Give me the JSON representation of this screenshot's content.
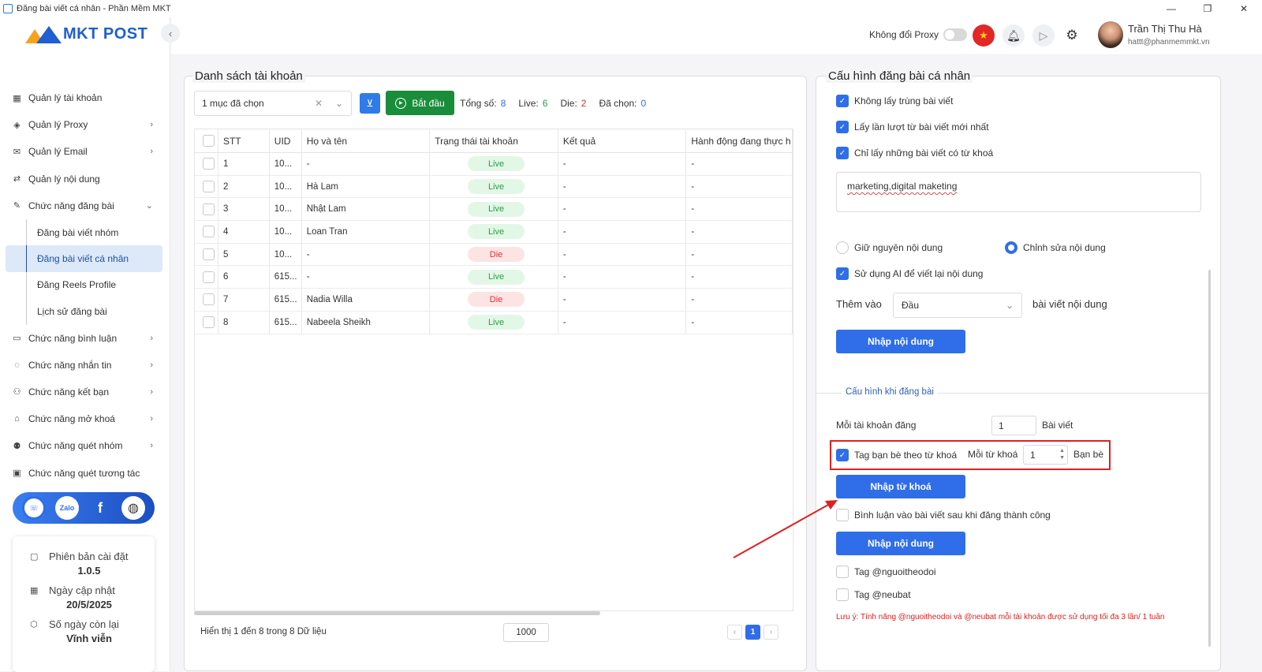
{
  "window": {
    "title": "Đăng bài viết cá nhân - Phần Mềm MKT",
    "controls": [
      "—",
      "❐",
      "✕"
    ]
  },
  "logo": {
    "text": "MKT POST"
  },
  "sidebar": {
    "items": [
      {
        "label": "Quản lý tài khoản",
        "icon": "grid-icon",
        "chev": ""
      },
      {
        "label": "Quản lý Proxy",
        "icon": "proxy-icon",
        "chev": "›"
      },
      {
        "label": "Quản lý Email",
        "icon": "email-icon",
        "chev": "›"
      },
      {
        "label": "Quản lý nội dung",
        "icon": "content-icon",
        "chev": ""
      },
      {
        "label": "Chức năng đăng bài",
        "icon": "post-icon",
        "chev": "⌄"
      }
    ],
    "subitems": [
      "Đăng bài viết nhóm",
      "Đăng bài viết cá nhân",
      "Đăng Reels Profile",
      "Lịch sử đăng bài"
    ],
    "items2": [
      {
        "label": "Chức năng bình luận",
        "icon": "comment-icon",
        "chev": "›"
      },
      {
        "label": "Chức năng nhắn tin",
        "icon": "message-icon",
        "chev": "›"
      },
      {
        "label": "Chức năng kết bạn",
        "icon": "add-friend-icon",
        "chev": "›"
      },
      {
        "label": "Chức năng mở khoá",
        "icon": "unlock-icon",
        "chev": "›"
      },
      {
        "label": "Chức năng quét nhóm",
        "icon": "group-icon",
        "chev": "›"
      },
      {
        "label": "Chức năng quét tương tác",
        "icon": "scan-icon",
        "chev": ""
      }
    ],
    "social": [
      "support-icon",
      "zalo-icon",
      "facebook-icon",
      "web-icon"
    ],
    "version": {
      "install_label": "Phiên bản cài đặt",
      "install_value": "1.0.5",
      "update_label": "Ngày cập nhật",
      "update_value": "20/5/2025",
      "days_label": "Số ngày còn lại",
      "days_value": "Vĩnh viễn"
    }
  },
  "topbar": {
    "proxy_label": "Không đổi Proxy",
    "user_name": "Trần Thị Thu Hà",
    "user_email": "hattt@phanmemmkt.vn"
  },
  "accounts": {
    "title": "Danh sách tài khoản",
    "select_value": "1 mục đã chọn",
    "start_label": "Bắt đầu",
    "total_label": "Tổng số:",
    "total": "8",
    "live_label": "Live:",
    "live": "6",
    "die_label": "Die:",
    "die": "2",
    "selected_label": "Đã chọn:",
    "selected": "0",
    "columns": [
      "STT",
      "UID",
      "Họ và tên",
      "Trạng thái tài khoản",
      "Kết quả",
      "Hành động đang thực h"
    ],
    "rows": [
      {
        "stt": "1",
        "uid": "10...",
        "name": "-",
        "status": "Live",
        "result": "-",
        "action": "-"
      },
      {
        "stt": "2",
        "uid": "10...",
        "name": "Hà Lam",
        "status": "Live",
        "result": "-",
        "action": "-"
      },
      {
        "stt": "3",
        "uid": "10...",
        "name": "Nhật Lam",
        "status": "Live",
        "result": "-",
        "action": "-"
      },
      {
        "stt": "4",
        "uid": "10...",
        "name": "Loan Tran",
        "status": "Live",
        "result": "-",
        "action": "-"
      },
      {
        "stt": "5",
        "uid": "10...",
        "name": "-",
        "status": "Die",
        "result": "-",
        "action": "-"
      },
      {
        "stt": "6",
        "uid": "615...",
        "name": "-",
        "status": "Live",
        "result": "-",
        "action": "-"
      },
      {
        "stt": "7",
        "uid": "615...",
        "name": "Nadia Willa",
        "status": "Die",
        "result": "-",
        "action": "-"
      },
      {
        "stt": "8",
        "uid": "615...",
        "name": "Nabeela Sheikh",
        "status": "Live",
        "result": "-",
        "action": "-"
      }
    ],
    "footer": "Hiển thị 1 đến 8 trong 8 Dữ liệu",
    "page_size": "1000",
    "page": "1"
  },
  "config": {
    "title": "Cấu hình đăng bài cá nhân",
    "opt_no_duplicate": "Không lấy trùng bài viết",
    "opt_newest": "Lấy lần lượt từ bài viết mới nhất",
    "opt_keyword_only": "Chỉ lấy những bài viết có từ khoá",
    "keywords": "marketing,digital maketing",
    "radio_keep": "Giữ nguyên nội dung",
    "radio_edit": "Chỉnh sửa nội dung",
    "opt_ai": "Sử dụng AI để viết lại nội dung",
    "add_label": "Thêm vào",
    "add_position": "Đầu",
    "add_suffix": "bài viết nội dung",
    "import_content": "Nhập nội dung",
    "section_title": "Cấu hình khi đăng bài",
    "per_account_label": "Mỗi tài khoản đăng",
    "per_account_value": "1",
    "per_account_unit": "Bài viết",
    "tag_friends_label": "Tag bạn bè theo từ khoá",
    "per_keyword_label": "Mỗi từ khoá",
    "per_keyword_value": "1",
    "friends_unit": "Bạn bè",
    "import_keywords": "Nhập từ khoá",
    "comment_after": "Bình luận vào bài viết sau khi đăng thành công",
    "import_content2": "Nhập nội dung",
    "tag_followers": "Tag @nguoitheodoi",
    "tag_neubat": "Tag @neubat",
    "note": "Lưu ý: Tính năng @nguoitheodoi và @neubat mỗi tài khoản được sử dụng tối đa 3 lần/ 1 tuần"
  },
  "colors": {
    "primary": "#2f6ee8",
    "start": "#1a8d3b",
    "live": "#2a9c48",
    "die": "#d93030",
    "highlight": "#e02020"
  }
}
